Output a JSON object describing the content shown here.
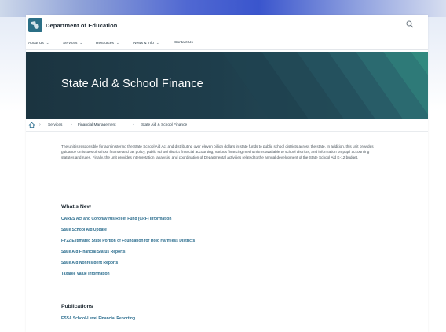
{
  "header": {
    "site_title": "Department of Education"
  },
  "nav": {
    "items": [
      {
        "label": "About Us",
        "has_dropdown": true
      },
      {
        "label": "Services",
        "has_dropdown": true
      },
      {
        "label": "Resources",
        "has_dropdown": true
      },
      {
        "label": "News & Info",
        "has_dropdown": true
      },
      {
        "label": "Contact Us",
        "has_dropdown": false
      }
    ]
  },
  "hero": {
    "title": "State Aid & School Finance"
  },
  "breadcrumb": {
    "items": [
      "Services",
      "Financial Management",
      "State Aid & School Finance"
    ]
  },
  "intro": {
    "text": "The unit is responsible for administering the State School Aid Act and distributing over eleven billion dollars in state funds to public school districts across the state. In addition, this unit provides guidance on issues of school finance and tax policy, public school district financial accounting, various financing mechanisms available to school districts, and information on pupil accounting statutes and rules. Finally, the unit provides interpretation, analysis, and coordination of Departmental activities related to the annual development of the State School Aid K-12 budget."
  },
  "whats_new": {
    "heading": "What's New",
    "links": [
      "CARES Act and Coronavirus Relief Fund (CRF) Information",
      "State School Aid Update",
      "FY22 Estimated State Portion of Foundation for Hold Harmless Districts",
      "State Aid Financial Status Reports",
      "State Aid Nonresident Reports",
      "Taxable Value Information"
    ]
  },
  "publications": {
    "heading": "Publications",
    "links": [
      "ESSA School-Level Financial Reporting"
    ]
  },
  "colors": {
    "hero_dark": "#1d3a48",
    "hero_teal": "#2f8a82",
    "link": "#2b6d8e",
    "logo": "#2b6f86"
  }
}
